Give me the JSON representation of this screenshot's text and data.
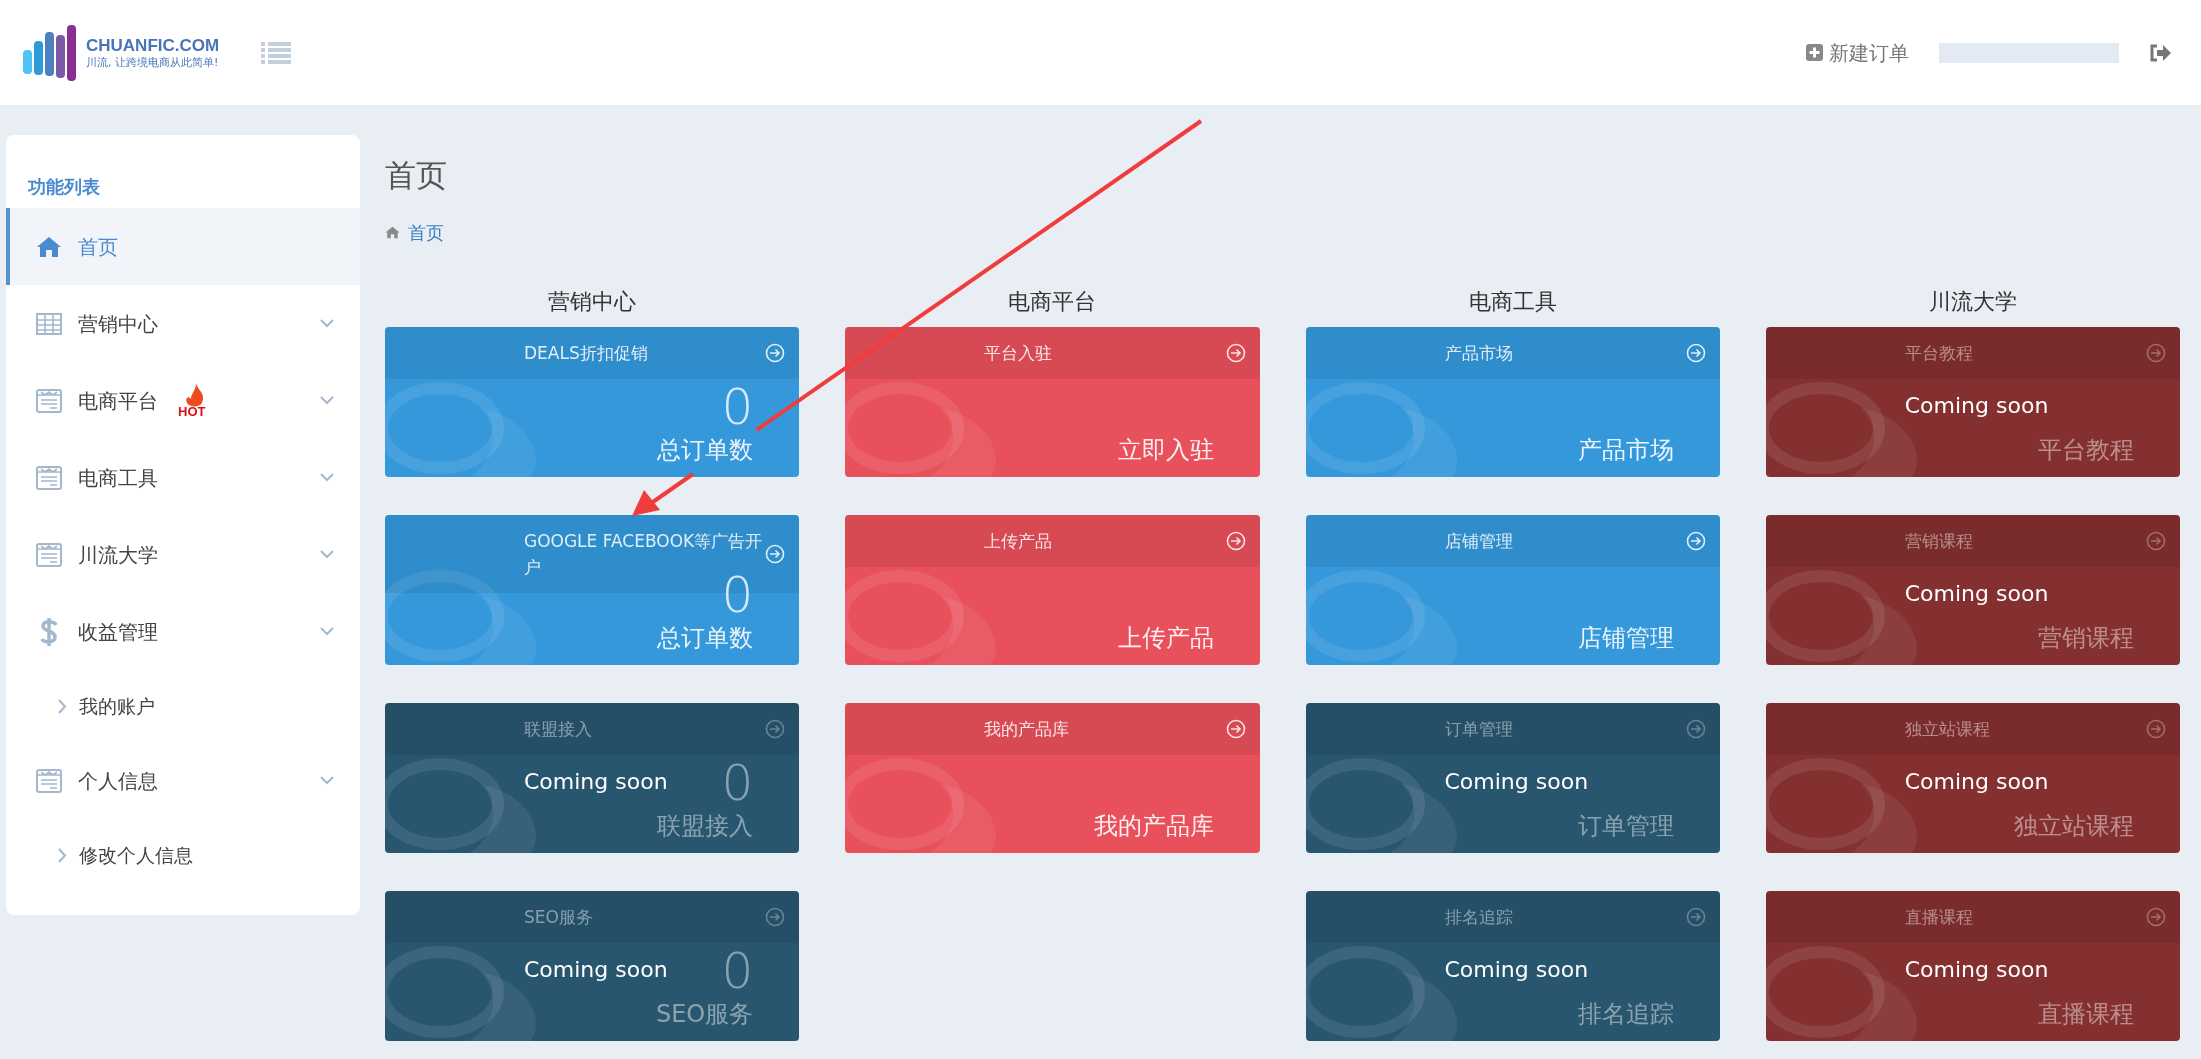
{
  "header": {
    "logo": {
      "name": "CHUANFIC.COM",
      "slogan": "川流, 让跨境电商从此简单!"
    },
    "new_order": "新建订单"
  },
  "sidebar": {
    "title": "功能列表",
    "items": [
      {
        "label": "首页",
        "kind": "home",
        "selected": true,
        "collapsible": false
      },
      {
        "label": "营销中心",
        "kind": "table",
        "selected": false,
        "collapsible": true
      },
      {
        "label": "电商平台",
        "kind": "list",
        "selected": false,
        "collapsible": true,
        "badge": "HOT"
      },
      {
        "label": "电商工具",
        "kind": "list",
        "selected": false,
        "collapsible": true
      },
      {
        "label": "川流大学",
        "kind": "list",
        "selected": false,
        "collapsible": true
      },
      {
        "label": "收益管理",
        "kind": "dollar",
        "selected": false,
        "collapsible": true,
        "children": [
          {
            "label": "我的账户"
          }
        ]
      },
      {
        "label": "个人信息",
        "kind": "list",
        "selected": false,
        "collapsible": true,
        "children": [
          {
            "label": "修改个人信息"
          }
        ]
      }
    ]
  },
  "page": {
    "title": "首页",
    "breadcrumb": "首页"
  },
  "columns": [
    {
      "title": "营销中心",
      "cards": [
        {
          "kind": "active",
          "title": "DEALS折扣促销",
          "value": "0",
          "label": "总订单数",
          "color": "#3498db"
        },
        {
          "kind": "active",
          "title": "GOOGLE FACEBOOK等广告开户",
          "value": "0",
          "label": "总订单数",
          "color": "#3498db"
        },
        {
          "kind": "coming_soon",
          "title": "联盟接入",
          "note": "Coming soon",
          "value": "0",
          "label": "联盟接入",
          "color": "#28566f"
        },
        {
          "kind": "coming_soon",
          "title": "SEO服务",
          "note": "Coming soon",
          "value": "0",
          "label": "SEO服务",
          "color": "#28566f"
        }
      ]
    },
    {
      "title": "电商平台",
      "cards": [
        {
          "kind": "active",
          "title": "平台入驻",
          "label": "立即入驻",
          "color": "#e8505b"
        },
        {
          "kind": "active",
          "title": "上传产品",
          "label": "上传产品",
          "color": "#e8505b"
        },
        {
          "kind": "active",
          "title": "我的产品库",
          "label": "我的产品库",
          "color": "#e8505b"
        }
      ]
    },
    {
      "title": "电商工具",
      "cards": [
        {
          "kind": "active",
          "title": "产品市场",
          "label": "产品市场",
          "color": "#3498db"
        },
        {
          "kind": "active",
          "title": "店铺管理",
          "label": "店铺管理",
          "color": "#3498db"
        },
        {
          "kind": "coming_soon",
          "title": "订单管理",
          "note": "Coming soon",
          "label": "订单管理",
          "color": "#28566f"
        },
        {
          "kind": "coming_soon",
          "title": "排名追踪",
          "note": "Coming soon",
          "label": "排名追踪",
          "color": "#28566f"
        }
      ]
    },
    {
      "title": "川流大学",
      "cards": [
        {
          "kind": "coming_soon",
          "title": "平台教程",
          "note": "Coming soon",
          "label": "平台教程",
          "color": "#843030"
        },
        {
          "kind": "coming_soon",
          "title": "营销课程",
          "note": "Coming soon",
          "label": "营销课程",
          "color": "#843030"
        },
        {
          "kind": "coming_soon",
          "title": "独立站课程",
          "note": "Coming soon",
          "label": "独立站课程",
          "color": "#843030"
        },
        {
          "kind": "coming_soon",
          "title": "直播课程",
          "note": "Coming soon",
          "label": "直播课程",
          "color": "#843030"
        }
      ]
    }
  ]
}
